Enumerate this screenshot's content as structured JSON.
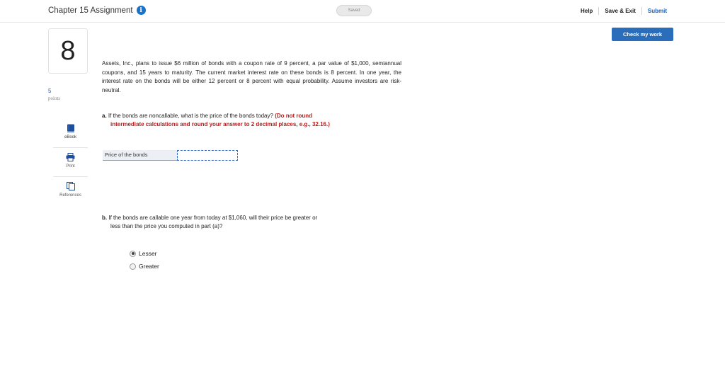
{
  "header": {
    "title": "Chapter 15 Assignment",
    "info_icon": "i",
    "saved_label": "Saved",
    "help": "Help",
    "save_exit": "Save & Exit",
    "submit": "Submit"
  },
  "check_work": "Check my work",
  "question": {
    "number": "8",
    "points_value": "5",
    "points_label": "points",
    "text": "Assets, Inc., plans to issue $6 million of bonds with a coupon rate of 9 percent, a par value of $1,000, semiannual coupons, and 15 years to maturity. The current market interest rate on these bonds is 8 percent. In one year, the interest rate on the bonds will be either 12 percent or 8 percent with equal probability. Assume investors are risk-neutral."
  },
  "tools": [
    {
      "label": "eBook",
      "icon": "book-icon"
    },
    {
      "label": "Print",
      "icon": "printer-icon"
    },
    {
      "label": "References",
      "icon": "references-icon"
    }
  ],
  "part_a": {
    "letter": "a.",
    "text": "If the bonds are noncallable, what is the price of the bonds today?",
    "instruction_line1": "(Do not round",
    "instruction_line2": "intermediate calculations and round your answer to 2 decimal places, e.g., 32.16.)",
    "answer_label": "Price of the bonds",
    "answer_value": ""
  },
  "part_b": {
    "letter": "b.",
    "line1": "If the bonds are callable one year from today at $1,060, will their price be greater or",
    "line2": "less than the price you computed in part (a)?",
    "options": [
      {
        "label": "Lesser",
        "selected": true
      },
      {
        "label": "Greater",
        "selected": false
      }
    ]
  },
  "colors": {
    "accent": "#2a6ebb",
    "instruction_red": "#b71c1c",
    "link_blue": "#1a5fb4"
  }
}
